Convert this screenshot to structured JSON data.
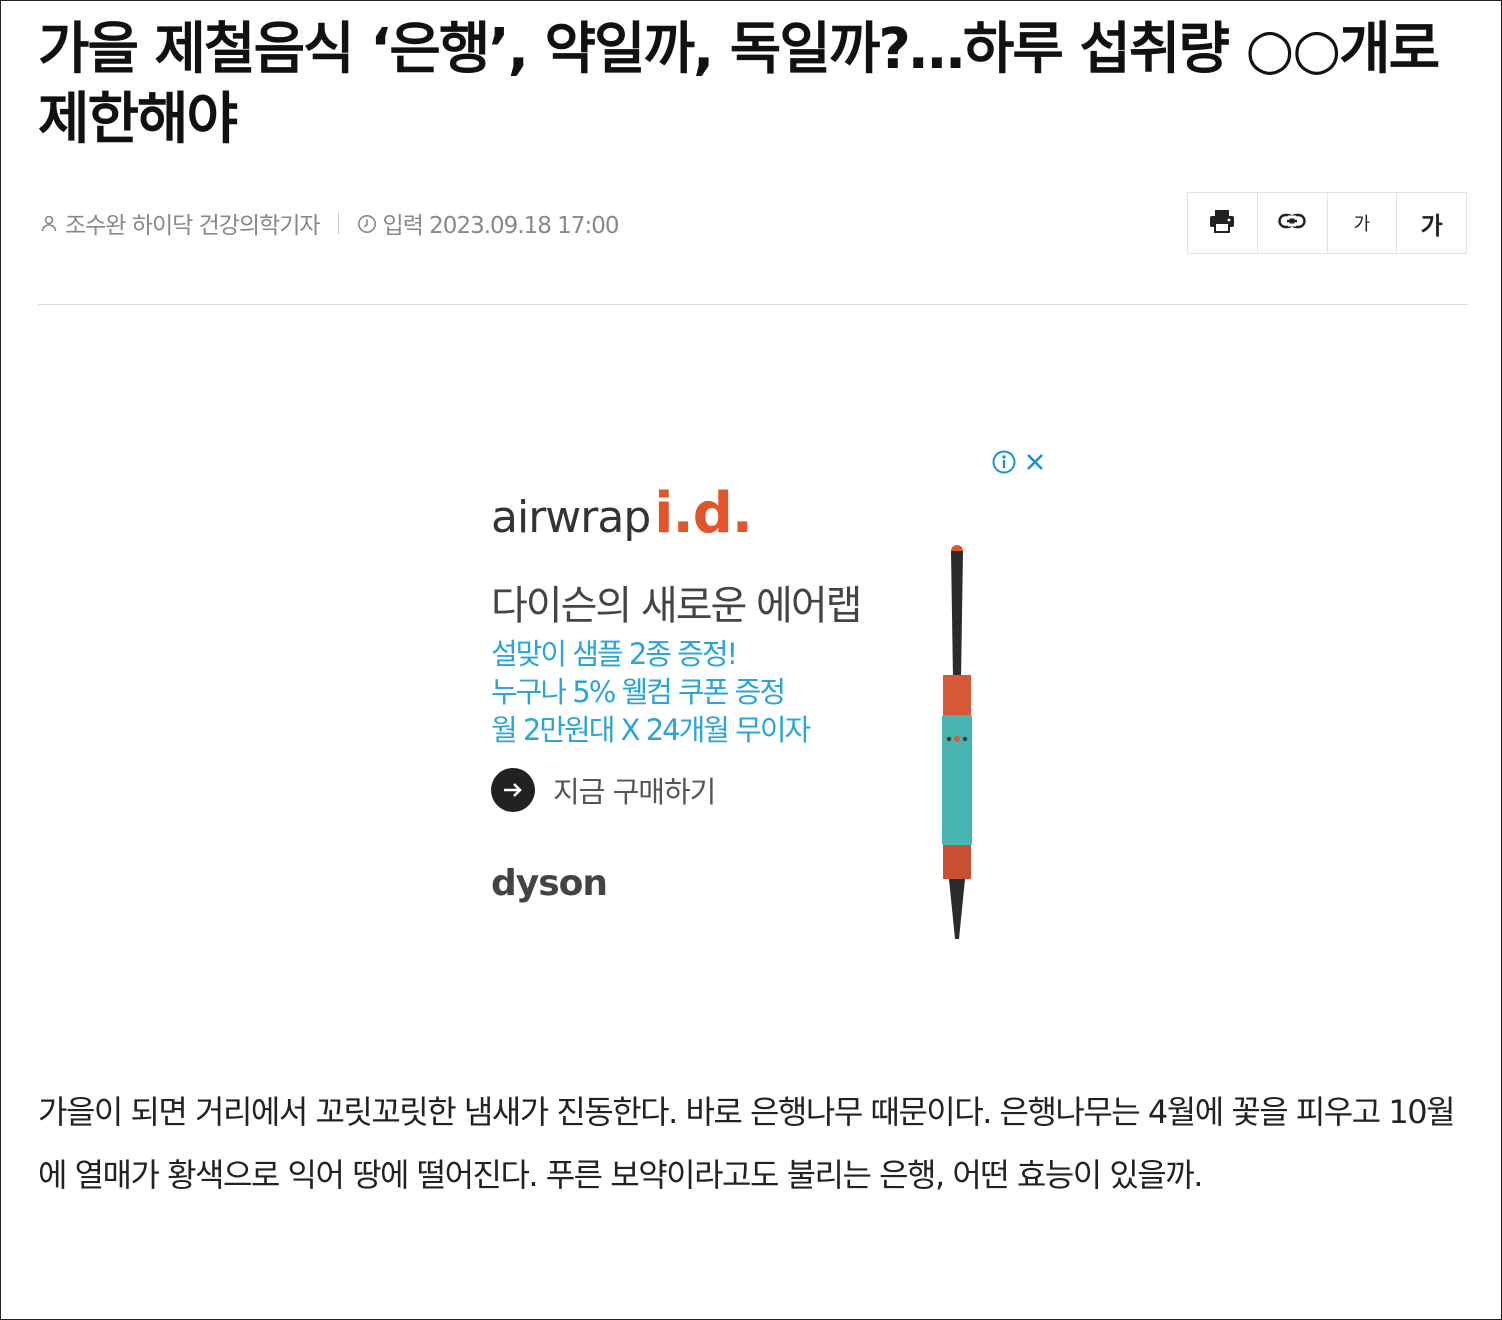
{
  "article": {
    "headline": "가을 제철음식 ‘은행’, 약일까, 독일까?…하루 섭취량 ○○개로 제한해야",
    "author": "조수완 하이닥 건강의학기자",
    "date": "입력 2023.09.18 17:00",
    "body": "가을이 되면 거리에서 꼬릿꼬릿한 냄새가 진동한다. 바로 은행나무 때문이다. 은행나무는 4월에 꽃을 피우고 10월에 열매가 황색으로 익어 땅에 떨어진다. 푸른 보약이라고도 불리는 은행, 어떤 효능이 있을까."
  },
  "tools": {
    "print_icon": "print-icon",
    "link_icon": "link-icon",
    "font_small_label": "가",
    "font_large_label": "가"
  },
  "ad": {
    "logo_main": "airwrap",
    "logo_accent": "i.d.",
    "heading": "다이슨의 새로운 에어랩",
    "lines": [
      "설맞이 샘플 2종 증정!",
      "누구나 5% 웰컴 쿠폰 증정",
      "월 2만원대 X 24개월 무이자"
    ],
    "cta": "지금 구매하기",
    "brand": "dyson",
    "accent_color": "#e2542c",
    "line_color": "#2ba4d9"
  }
}
